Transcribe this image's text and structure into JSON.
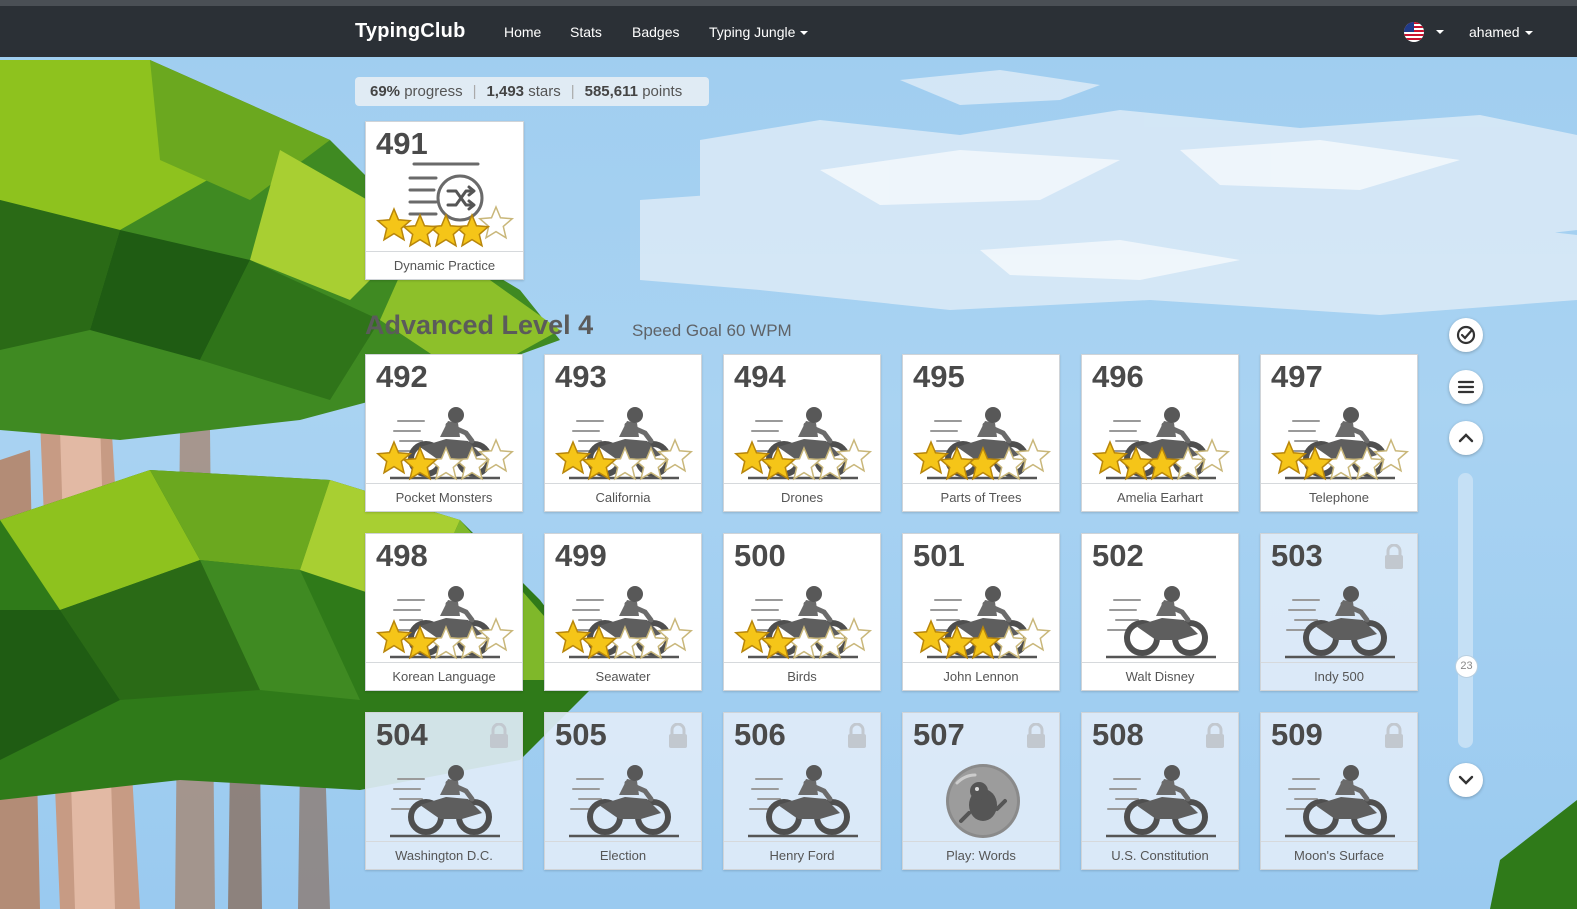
{
  "navbar": {
    "brand": "TypingClub",
    "links": [
      "Home",
      "Stats",
      "Badges"
    ],
    "dropdown": "Typing Jungle",
    "user": "ahamed"
  },
  "stats": {
    "progress": "69%",
    "progress_label": "progress",
    "stars": "1,493",
    "stars_label": "stars",
    "points": "585,611",
    "points_label": "points"
  },
  "dynamic_card": {
    "num": "491",
    "name": "Dynamic Practice",
    "stars": 4,
    "icon": "shuffle-list-icon"
  },
  "level": {
    "title": "Advanced Level 4",
    "goal": "Speed Goal 60 WPM"
  },
  "lessons": [
    {
      "num": "492",
      "name": "Pocket Monsters",
      "stars": 2,
      "locked": false,
      "icon": "motorcycle-icon"
    },
    {
      "num": "493",
      "name": "California",
      "stars": 2,
      "locked": false,
      "icon": "motorcycle-icon"
    },
    {
      "num": "494",
      "name": "Drones",
      "stars": 2,
      "locked": false,
      "icon": "motorcycle-icon"
    },
    {
      "num": "495",
      "name": "Parts of Trees",
      "stars": 3,
      "locked": false,
      "icon": "motorcycle-icon"
    },
    {
      "num": "496",
      "name": "Amelia Earhart",
      "stars": 3,
      "locked": false,
      "icon": "motorcycle-icon"
    },
    {
      "num": "497",
      "name": "Telephone",
      "stars": 2,
      "locked": false,
      "icon": "motorcycle-icon"
    },
    {
      "num": "498",
      "name": "Korean Language",
      "stars": 2,
      "locked": false,
      "icon": "motorcycle-icon"
    },
    {
      "num": "499",
      "name": "Seawater",
      "stars": 2,
      "locked": false,
      "icon": "motorcycle-icon"
    },
    {
      "num": "500",
      "name": "Birds",
      "stars": 2,
      "locked": false,
      "icon": "motorcycle-icon"
    },
    {
      "num": "501",
      "name": "John Lennon",
      "stars": 3,
      "locked": false,
      "icon": "motorcycle-icon"
    },
    {
      "num": "502",
      "name": "Walt Disney",
      "stars": 0,
      "locked": false,
      "icon": "motorcycle-icon"
    },
    {
      "num": "503",
      "name": "Indy 500",
      "stars": 0,
      "locked": true,
      "icon": "motorcycle-icon"
    },
    {
      "num": "504",
      "name": "Washington D.C.",
      "stars": 0,
      "locked": true,
      "icon": "motorcycle-icon"
    },
    {
      "num": "505",
      "name": "Election",
      "stars": 0,
      "locked": true,
      "icon": "motorcycle-icon"
    },
    {
      "num": "506",
      "name": "Henry Ford",
      "stars": 0,
      "locked": true,
      "icon": "motorcycle-icon"
    },
    {
      "num": "507",
      "name": "Play: Words",
      "stars": 0,
      "locked": true,
      "icon": "game-bubble-icon"
    },
    {
      "num": "508",
      "name": "U.S. Constitution",
      "stars": 0,
      "locked": true,
      "icon": "motorcycle-icon"
    },
    {
      "num": "509",
      "name": "Moon's Surface",
      "stars": 0,
      "locked": true,
      "icon": "motorcycle-icon"
    }
  ],
  "rail": {
    "position": "23"
  },
  "colors": {
    "navbar": "#2b3036",
    "star": "#f5c518",
    "sky": "#a9d3f2"
  }
}
